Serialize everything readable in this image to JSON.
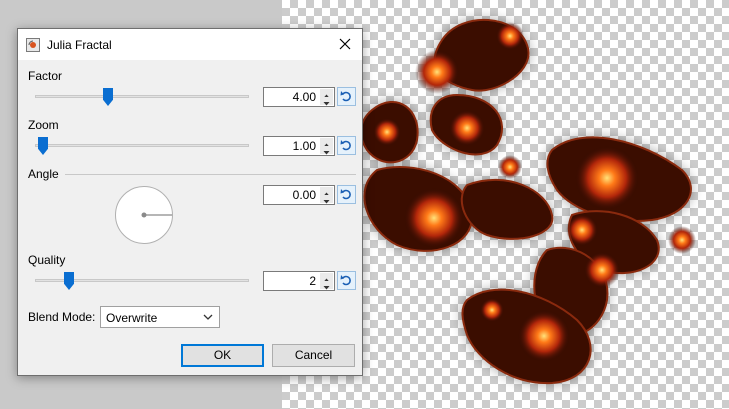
{
  "dialog": {
    "title": "Julia Fractal",
    "factor": {
      "label": "Factor",
      "value": "4.00",
      "slider_fraction": 0.34
    },
    "zoom": {
      "label": "Zoom",
      "value": "1.00",
      "slider_fraction": 0.0
    },
    "angle": {
      "label": "Angle",
      "value": "0.00"
    },
    "quality": {
      "label": "Quality",
      "value": "2",
      "slider_fraction": 0.12
    },
    "blend_mode": {
      "label": "Blend Mode:",
      "selected": "Overwrite"
    },
    "ok_label": "OK",
    "cancel_label": "Cancel"
  },
  "colors": {
    "accent": "#0a6ed1",
    "fractal_dark": "#2a0a04",
    "fractal_orange": "#ff6a10",
    "fractal_yellow": "#ffd24a"
  },
  "icons": [
    "app-icon",
    "close-icon",
    "spin-up-icon",
    "spin-down-icon",
    "reset-icon",
    "chevron-down-icon"
  ]
}
